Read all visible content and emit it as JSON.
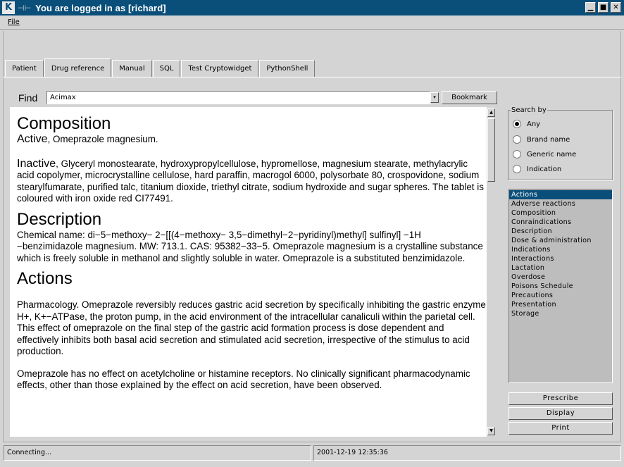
{
  "window": {
    "title": "You are logged in as [richard]",
    "app_icon": "K",
    "pin_icon": "⊣⊢",
    "buttons": [
      "▁",
      "■",
      "✕"
    ]
  },
  "menu": {
    "file": "File"
  },
  "tabs": [
    "Patient",
    "Drug reference",
    "Manual",
    "SQL",
    "Test Cryptowidget",
    "PythonShell"
  ],
  "active_tab": "Drug reference",
  "find": {
    "label": "Find",
    "value": "Acimax",
    "bookmark_label": "Bookmark"
  },
  "document": {
    "composition_heading": "Composition",
    "active_label": "Active",
    "active_text": ", Omeprazole magnesium.",
    "inactive_label": "Inactive",
    "inactive_text": ", Glyceryl monostearate, hydroxypropylcellulose, hypromellose, magnesium stearate, methylacrylic acid copolymer, microcrystalline cellulose, hard paraffin, macrogol 6000, polysorbate 80, crospovidone, sodium stearylfumarate, purified talc, titanium dioxide, triethyl citrate, sodium hydroxide and sugar spheres. The tablet is coloured with iron oxide red CI77491.",
    "description_heading": "Description",
    "description_text": "Chemical name: di−5−methoxy− 2−[[(4−methoxy− 3,5−dimethyl−2−pyridinyl)methyl] sulfinyl] −1H −benzimidazole magnesium. MW: 713.1. CAS: 95382−33−5. Omeprazole magnesium is a crystalline substance which is freely soluble in methanol and slightly soluble in water. Omeprazole is a substituted benzimidazole.",
    "actions_heading": "Actions",
    "actions_p1": "Pharmacology. Omeprazole reversibly reduces gastric acid secretion by specifically inhibiting the gastric enzyme H+, K+−ATPase, the proton pump, in the acid environment of the intracellular canaliculi within the parietal cell. This effect of omeprazole on the final step of the gastric acid formation process is dose dependent and effectively inhibits both basal acid secretion and stimulated acid secretion, irrespective of the stimulus to acid production.",
    "actions_p2": "Omeprazole has no effect on acetylcholine or histamine receptors. No clinically significant pharmacodynamic effects, other than those explained by the effect on acid secretion, have been observed."
  },
  "search_by": {
    "legend": "Search by",
    "options": [
      "Any",
      "Brand name",
      "Generic name",
      "Indication"
    ],
    "selected": "Any"
  },
  "sections": [
    "Actions",
    "Adverse reactions",
    "Composition",
    "Conraindications",
    "Description",
    "Dose & administration",
    "Indications",
    "Interactions",
    "Lactation",
    "Overdose",
    "Poisons Schedule",
    "Precautions",
    "Presentation",
    "Storage"
  ],
  "selected_section": "Actions",
  "actions": {
    "prescribe": "Prescribe",
    "display": "Display",
    "print": "Print"
  },
  "status": {
    "message": "Connecting...",
    "datetime": "2001-12-19  12:35:36"
  },
  "colors": {
    "titlebar": "#0a4f7a",
    "selection": "#0a4f7a",
    "background": "#d4d4d4"
  }
}
